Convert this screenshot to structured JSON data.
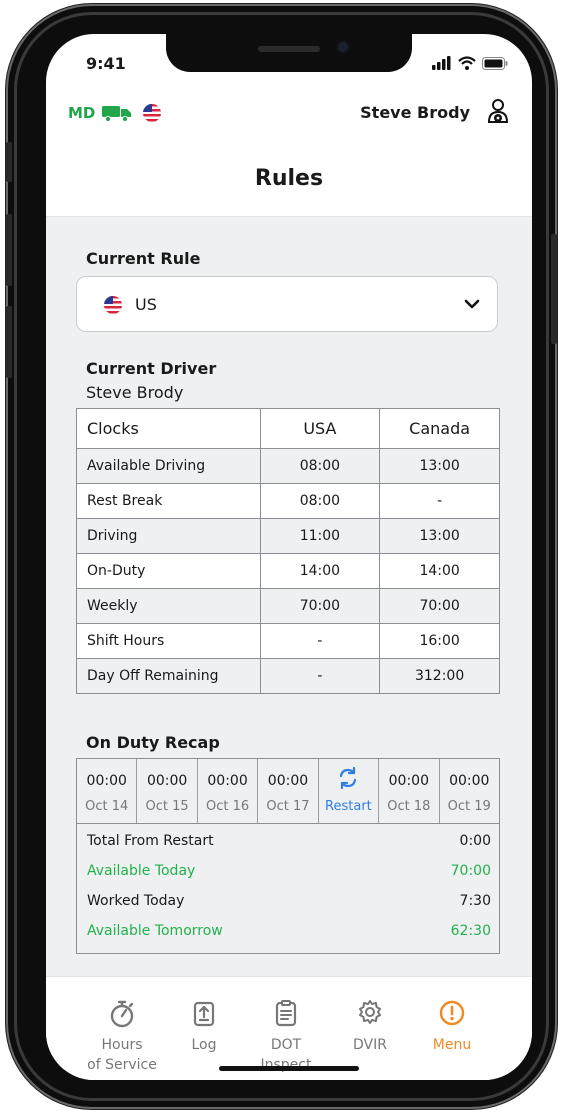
{
  "status_bar": {
    "time": "9:41"
  },
  "top_bar": {
    "region_code": "MD",
    "driver_name": "Steve Brody",
    "colors": {
      "region": "#22a64a",
      "truck": "#22a64a"
    }
  },
  "page": {
    "title": "Rules"
  },
  "current_rule": {
    "section_title": "Current Rule",
    "selected_value": "US",
    "flag_icon": "us-flag-icon",
    "dropdown_icon": "chevron-down-icon"
  },
  "current_driver": {
    "section_title": "Current Driver",
    "name": "Steve Brody"
  },
  "clocks_table": {
    "headers": [
      "Clocks",
      "USA",
      "Canada"
    ],
    "rows": [
      [
        "Available Driving",
        "08:00",
        "13:00"
      ],
      [
        "Rest Break",
        "08:00",
        "-"
      ],
      [
        "Driving",
        "11:00",
        "13:00"
      ],
      [
        "On-Duty",
        "14:00",
        "14:00"
      ],
      [
        "Weekly",
        "70:00",
        "70:00"
      ],
      [
        "Shift Hours",
        "-",
        "16:00"
      ],
      [
        "Day Off Remaining",
        "-",
        "312:00"
      ]
    ]
  },
  "recap": {
    "section_title": "On Duty Recap",
    "days": [
      {
        "time": "00:00",
        "date": "Oct 14"
      },
      {
        "time": "00:00",
        "date": "Oct 15"
      },
      {
        "time": "00:00",
        "date": "Oct 16"
      },
      {
        "time": "00:00",
        "date": "Oct 17"
      },
      {
        "time": "",
        "date": "Restart"
      },
      {
        "time": "00:00",
        "date": "Oct 18"
      },
      {
        "time": "00:00",
        "date": "Oct 19"
      }
    ],
    "summary": [
      {
        "label": "Total From Restart",
        "value": "0:00"
      },
      {
        "label": "Available Today",
        "value": "70:00"
      },
      {
        "label": "Worked Today",
        "value": "7:30"
      },
      {
        "label": "Available Tomorrow",
        "value": "62:30"
      }
    ],
    "colors": {
      "available": "#22b14c",
      "restart": "#2f7fe0"
    }
  },
  "tab_bar": {
    "tabs": [
      {
        "label": "Hours\nof Service",
        "icon": "stopwatch-icon"
      },
      {
        "label": "Log",
        "icon": "upload-document-icon"
      },
      {
        "label": "DOT\nInspect",
        "icon": "clipboard-icon"
      },
      {
        "label": "DVIR",
        "icon": "gear-icon"
      },
      {
        "label": "Menu",
        "icon": "info-circle-icon"
      }
    ],
    "active_color": "#f08a24"
  }
}
